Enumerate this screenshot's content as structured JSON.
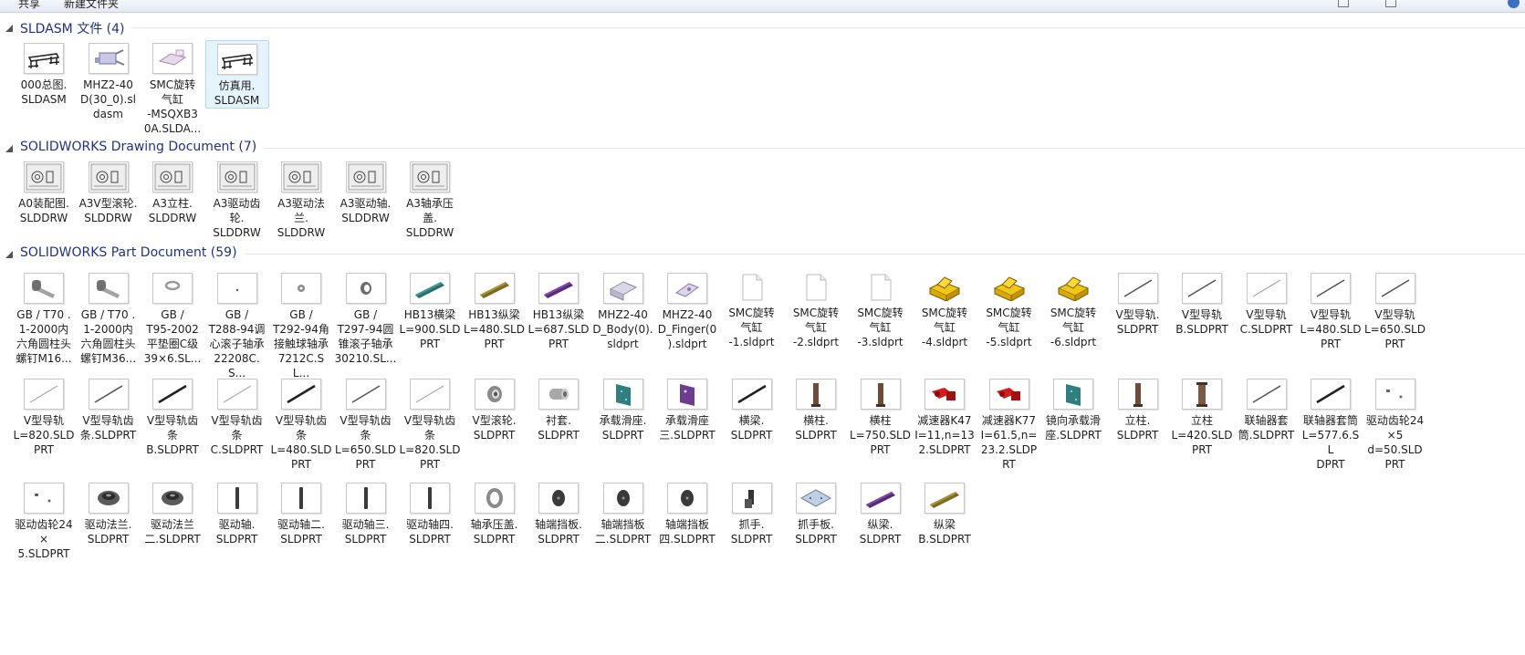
{
  "toolbar": {
    "share_label": "共享",
    "new_folder_label": "新建文件夹"
  },
  "sections": [
    {
      "title": "SLDASM 文件 (4)",
      "items": [
        {
          "label": "000总图.\nSLDASM",
          "icon": "assembly-frame-icon"
        },
        {
          "label": "MHZ2-40\nD(30_0).sl\ndasm",
          "icon": "gripper-assembly-icon"
        },
        {
          "label": "SMC旋转\n气缸\n-MSQXB3\n0A.SLDA...",
          "icon": "rotary-cylinder-assembly-icon"
        },
        {
          "label": "仿真用.\nSLDASM",
          "icon": "assembly-frame-icon",
          "selected": true
        }
      ]
    },
    {
      "title": "SOLIDWORKS Drawing Document (7)",
      "items": [
        {
          "label": "A0装配图.\nSLDDRW",
          "icon": "drawing-sheet-icon"
        },
        {
          "label": "A3V型滚轮.\nSLDDRW",
          "icon": "drawing-sheet-icon"
        },
        {
          "label": "A3立柱.\nSLDDRW",
          "icon": "drawing-sheet-icon"
        },
        {
          "label": "A3驱动齿\n轮.\nSLDDRW",
          "icon": "drawing-sheet-icon"
        },
        {
          "label": "A3驱动法\n兰.\nSLDDRW",
          "icon": "drawing-sheet-icon"
        },
        {
          "label": "A3驱动轴.\nSLDDRW",
          "icon": "drawing-sheet-icon"
        },
        {
          "label": "A3轴承压\n盖.\nSLDDRW",
          "icon": "drawing-sheet-icon"
        }
      ]
    },
    {
      "title": "SOLIDWORKS Part Document (59)",
      "items": [
        {
          "label": "GB / T70 .\n1-2000内\n六角圆柱头\n螺钉M16...",
          "icon": "bolt-icon"
        },
        {
          "label": "GB / T70 .\n1-2000内\n六角圆柱头\n螺钉M36...",
          "icon": "bolt-icon"
        },
        {
          "label": "GB /\nT95-2002\n平垫圈C级\n39×6.SL...",
          "icon": "washer-icon"
        },
        {
          "label": "GB /\nT288-94调\n心滚子轴承\n22208C.S...",
          "icon": "dot-part-icon"
        },
        {
          "label": "GB /\nT292-94角\n接触球轴承\n7212C.SL...",
          "icon": "small-bearing-icon"
        },
        {
          "label": "GB /\nT297-94圆\n锥滚子轴承\n30210.SL...",
          "icon": "bearing-icon"
        },
        {
          "label": "HB13横梁\nL=900.SLD\nPRT",
          "icon": "teal-beam-icon"
        },
        {
          "label": "HB13纵梁\nL=480.SLD\nPRT",
          "icon": "olive-beam-icon"
        },
        {
          "label": "HB13纵梁\nL=687.SLD\nPRT",
          "icon": "purple-beam-icon"
        },
        {
          "label": "MHZ2-40\nD_Body(0).\nsldprt",
          "icon": "gripper-body-icon"
        },
        {
          "label": "MHZ2-40\nD_Finger(0\n).sldprt",
          "icon": "gripper-finger-icon"
        },
        {
          "label": "SMC旋转\n气缸\n-1.sldprt",
          "icon": "blank-document-icon"
        },
        {
          "label": "SMC旋转\n气缸\n-2.sldprt",
          "icon": "blank-document-icon"
        },
        {
          "label": "SMC旋转\n气缸\n-3.sldprt",
          "icon": "blank-document-icon"
        },
        {
          "label": "SMC旋转\n气缸\n-4.sldprt",
          "icon": "yellow-part-icon"
        },
        {
          "label": "SMC旋转\n气缸\n-5.sldprt",
          "icon": "yellow-part-icon"
        },
        {
          "label": "SMC旋转\n气缸\n-6.sldprt",
          "icon": "yellow-part-icon"
        },
        {
          "label": "V型导轨.\nSLDPRT",
          "icon": "rail-icon"
        },
        {
          "label": "V型导轨\nB.SLDPRT",
          "icon": "rail-icon"
        },
        {
          "label": "V型导轨\nC.SLDPRT",
          "icon": "light-rail-icon"
        },
        {
          "label": "V型导轨\nL=480.SLD\nPRT",
          "icon": "rail-icon"
        },
        {
          "label": "V型导轨\nL=650.SLD\nPRT",
          "icon": "rail-icon"
        },
        {
          "label": "V型导轨\nL=820.SLD\nPRT",
          "icon": "light-rail-icon"
        },
        {
          "label": "V型导轨齿\n条.SLDPRT",
          "icon": "rail-icon"
        },
        {
          "label": "V型导轨齿\n条\nB.SLDPRT",
          "icon": "dark-rail-icon"
        },
        {
          "label": "V型导轨齿\n条\nC.SLDPRT",
          "icon": "light-rail-icon"
        },
        {
          "label": "V型导轨齿\n条\nL=480.SLD\nPRT",
          "icon": "dark-rail-icon"
        },
        {
          "label": "V型导轨齿\n条\nL=650.SLD\nPRT",
          "icon": "rail-icon"
        },
        {
          "label": "V型导轨齿\n条\nL=820.SLD\nPRT",
          "icon": "light-rail-icon"
        },
        {
          "label": "V型滚轮.\nSLDPRT",
          "icon": "roller-icon"
        },
        {
          "label": "衬套.\nSLDPRT",
          "icon": "bushing-icon"
        },
        {
          "label": "承载滑座.\nSLDPRT",
          "icon": "teal-plate-icon"
        },
        {
          "label": "承载滑座\n三.SLDPRT",
          "icon": "purple-plate-icon"
        },
        {
          "label": "横梁.\nSLDPRT",
          "icon": "dark-rail-icon"
        },
        {
          "label": "横柱.\nSLDPRT",
          "icon": "column-icon"
        },
        {
          "label": "横柱\nL=750.SLD\nPRT",
          "icon": "column-icon"
        },
        {
          "label": "减速器K47\nI=11,n=13\n2.SLDPRT",
          "icon": "red-reducer-icon"
        },
        {
          "label": "减速器K77\nI=61.5,n=\n23.2.SLDP\nRT",
          "icon": "red-reducer-icon"
        },
        {
          "label": "镜向承载滑\n座.SLDPRT",
          "icon": "teal-plate-icon"
        },
        {
          "label": "立柱.\nSLDPRT",
          "icon": "column-icon"
        },
        {
          "label": "立柱\nL=420.SLD\nPRT",
          "icon": "tall-column-icon"
        },
        {
          "label": "联轴器套\n筒.SLDPRT",
          "icon": "rail-icon"
        },
        {
          "label": "联轴器套筒\nL=577.6.SL\nDPRT",
          "icon": "dark-rail-icon"
        },
        {
          "label": "驱动齿轮24\n×5\nd=50.SLD\nPRT",
          "icon": "small-gear-icon"
        },
        {
          "label": "驱动齿轮24\n×\n5.SLDPRT",
          "icon": "small-gear-icon"
        },
        {
          "label": "驱动法兰.\nSLDPRT",
          "icon": "flange-icon"
        },
        {
          "label": "驱动法兰\n二.SLDPRT",
          "icon": "flange-icon"
        },
        {
          "label": "驱动轴.\nSLDPRT",
          "icon": "shaft-icon"
        },
        {
          "label": "驱动轴二.\nSLDPRT",
          "icon": "shaft-icon"
        },
        {
          "label": "驱动轴三.\nSLDPRT",
          "icon": "shaft-icon"
        },
        {
          "label": "驱动轴四.\nSLDPRT",
          "icon": "shaft-icon"
        },
        {
          "label": "轴承压盖.\nSLDPRT",
          "icon": "ring-icon"
        },
        {
          "label": "轴端挡板.\nSLDPRT",
          "icon": "end-plate-icon"
        },
        {
          "label": "轴端挡板\n二.SLDPRT",
          "icon": "end-plate-icon"
        },
        {
          "label": "轴端挡板\n四.SLDPRT",
          "icon": "end-plate-icon"
        },
        {
          "label": "抓手.\nSLDPRT",
          "icon": "gripper-hand-icon"
        },
        {
          "label": "抓手板.\nSLDPRT",
          "icon": "gripper-plate-icon"
        },
        {
          "label": "纵梁.\nSLDPRT",
          "icon": "purple-beam-icon"
        },
        {
          "label": "纵梁\nB.SLDPRT",
          "icon": "olive-beam-icon"
        }
      ]
    }
  ]
}
